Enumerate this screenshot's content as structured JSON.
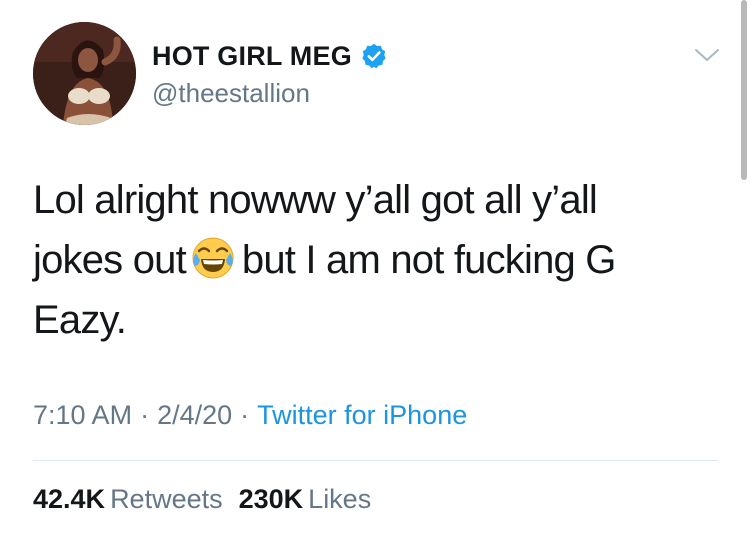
{
  "user": {
    "display_name": "HOT GIRL MEG",
    "handle": "@theestallion",
    "verified": true,
    "avatar_icon": "profile-photo"
  },
  "tweet": {
    "line1": "Lol alright nowww y’all got all y’all",
    "line2_before_emoji": "jokes out",
    "emoji": "face-with-tears-of-joy-icon",
    "line2_after_emoji": "but I am not fucking G",
    "line3": "Eazy."
  },
  "meta": {
    "time": "7:10 AM",
    "separator": "·",
    "date": "2/4/20",
    "source": "Twitter for iPhone"
  },
  "stats": {
    "retweets_count": "42.4K",
    "retweets_label": "Retweets",
    "likes_count": "230K",
    "likes_label": "Likes"
  },
  "colors": {
    "text": "#14171a",
    "secondary": "#657786",
    "link": "#1b95e0",
    "verified": "#1da1f2",
    "divider": "#e1e8ed"
  }
}
